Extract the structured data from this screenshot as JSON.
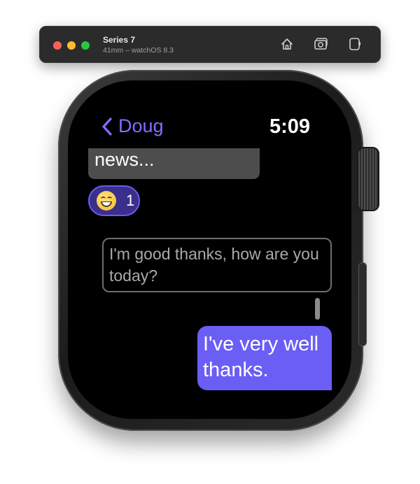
{
  "simulator": {
    "device_name": "Series 7",
    "device_detail": "41mm – watchOS 8.3",
    "buttons": [
      "home-icon",
      "screenshot-icon",
      "rotate-icon"
    ]
  },
  "watch": {
    "header": {
      "back_label": "Doug",
      "time": "5:09"
    },
    "messages": {
      "incoming_text": "news...",
      "reaction_count": "1",
      "draft_text": "I'm good thanks, how are you today?",
      "outgoing_text": "I've very well thanks."
    },
    "colors": {
      "accent": "#7f6fff",
      "outgoing_bubble": "#6b5ef5",
      "incoming_bubble": "#4d4d4d"
    }
  }
}
